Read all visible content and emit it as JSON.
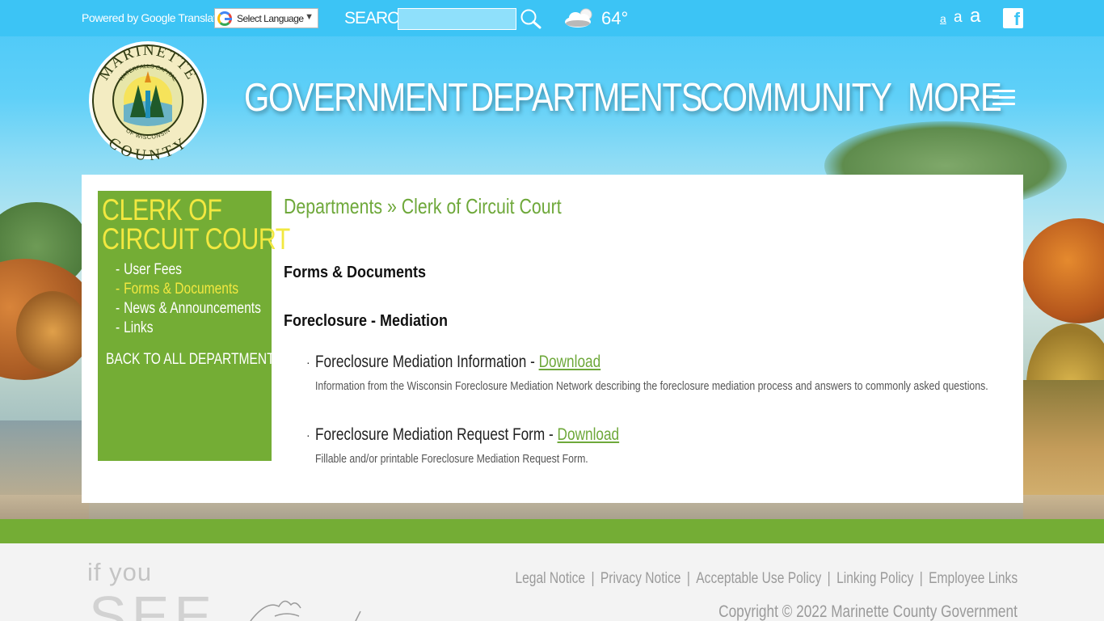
{
  "topbar": {
    "powered_by": "Powered by Google Translate",
    "language_select": "Select Language",
    "search_label": "SEARCH",
    "search_value": "",
    "temperature": "64°",
    "font_small": "a",
    "font_medium": "a",
    "font_large": "a",
    "facebook_glyph": "f",
    "icons": [
      "google-icon",
      "search-icon",
      "cloud-sun-icon",
      "facebook-icon"
    ]
  },
  "logo": {
    "top_text": "MARINETTE",
    "bottom_text": "COUNTY",
    "inner_top": "WATERFALLS CAPITAL",
    "inner_bottom": "OF WISCONSIN"
  },
  "nav": {
    "items": [
      {
        "label": "GOVERNMENT"
      },
      {
        "label": "DEPARTMENTS"
      },
      {
        "label": "COMMUNITY"
      },
      {
        "label": "MORE"
      }
    ]
  },
  "sidebar": {
    "title_line1": "CLERK OF",
    "title_line2": "CIRCUIT COURT",
    "items": [
      {
        "label": "User Fees"
      },
      {
        "label": "Forms & Documents"
      },
      {
        "label": "News & Announcements"
      },
      {
        "label": "Links"
      }
    ],
    "back": "BACK TO ALL DEPARTMENTS"
  },
  "main": {
    "breadcrumb_parent": "Departments",
    "breadcrumb_sep": "»",
    "breadcrumb_current": "Clerk of Circuit Court",
    "section_heading": "Forms & Documents",
    "sub_heading": "Foreclosure - Mediation",
    "docs": [
      {
        "title": "Foreclosure Mediation Information - ",
        "link": "Download",
        "description": "Information from the Wisconsin Foreclosure Mediation Network describing the foreclosure mediation process and answers to commonly asked questions."
      },
      {
        "title": "Foreclosure Mediation Request Form - ",
        "link": "Download",
        "description": "Fillable and/or printable Foreclosure Mediation Request Form."
      }
    ]
  },
  "footer": {
    "tagline_small": "if you",
    "tagline_big": "SEE",
    "links": [
      "Legal Notice",
      "Privacy Notice",
      "Acceptable Use Policy",
      "Linking Policy",
      "Employee Links"
    ],
    "separator": "|",
    "copyright": "Copyright © 2022 Marinette County Government"
  },
  "colors": {
    "topbar": "#3cc4f5",
    "accent_green": "#74ad35",
    "sidebar_title": "#f2e840",
    "link_green": "#6ea83a"
  }
}
